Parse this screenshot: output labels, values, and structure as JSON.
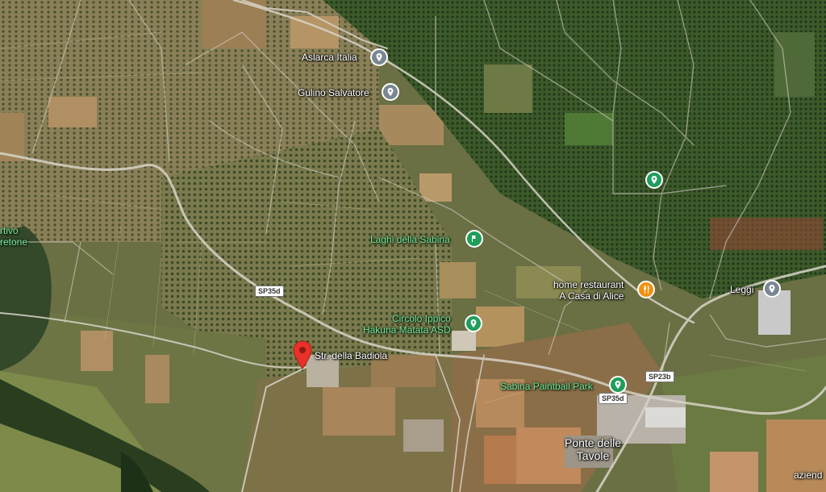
{
  "map": {
    "view": "satellite"
  },
  "places": {
    "aslarca": "Aslarca Italia",
    "gulino": "Gulino Salvatore",
    "laghi": "Laghi della Sabina",
    "circolo_line1": "Circolo Ippico",
    "circolo_line2": "Hakuna Matata ASD",
    "home_line1": "home restaurant",
    "home_line2": "A Casa di Alice",
    "leggi": "Leggi",
    "paintball": "Sabina Paintball Park",
    "badiola": "Str. della Badiola",
    "ponte_line1": "Ponte delle",
    "ponte_line2": "Tavole",
    "edge_left_1": "rtivo",
    "edge_left_2": "retone",
    "edge_bottom_right": "aziend"
  },
  "roads": {
    "sp35d_top": "SP35d",
    "sp35d_bottom": "SP35d",
    "sp23b": "SP23b"
  },
  "icons": {
    "grey_pin": "location-pin-icon",
    "green_pin": "park-icon",
    "orange_pin": "restaurant-icon",
    "red_marker": "selected-location-marker"
  },
  "colors": {
    "grey_pin": "#7a8793",
    "green_pin": "#1e9e5a",
    "orange_pin": "#f2910f",
    "red_marker": "#e8312a",
    "green_label": "#7ee29a"
  }
}
